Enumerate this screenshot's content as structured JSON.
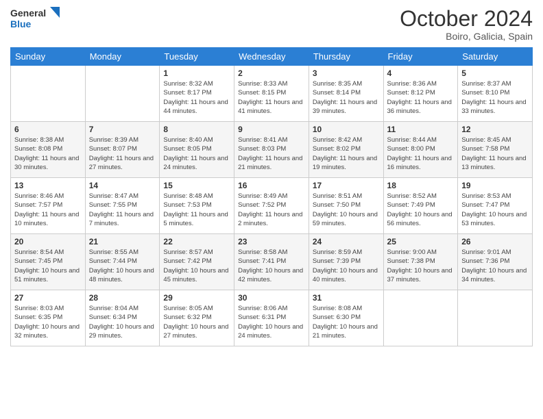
{
  "logo": {
    "general": "General",
    "blue": "Blue"
  },
  "title": "October 2024",
  "subtitle": "Boiro, Galicia, Spain",
  "days_header": [
    "Sunday",
    "Monday",
    "Tuesday",
    "Wednesday",
    "Thursday",
    "Friday",
    "Saturday"
  ],
  "weeks": [
    [
      {
        "day": "",
        "info": ""
      },
      {
        "day": "",
        "info": ""
      },
      {
        "day": "1",
        "info": "Sunrise: 8:32 AM\nSunset: 8:17 PM\nDaylight: 11 hours and 44 minutes."
      },
      {
        "day": "2",
        "info": "Sunrise: 8:33 AM\nSunset: 8:15 PM\nDaylight: 11 hours and 41 minutes."
      },
      {
        "day": "3",
        "info": "Sunrise: 8:35 AM\nSunset: 8:14 PM\nDaylight: 11 hours and 39 minutes."
      },
      {
        "day": "4",
        "info": "Sunrise: 8:36 AM\nSunset: 8:12 PM\nDaylight: 11 hours and 36 minutes."
      },
      {
        "day": "5",
        "info": "Sunrise: 8:37 AM\nSunset: 8:10 PM\nDaylight: 11 hours and 33 minutes."
      }
    ],
    [
      {
        "day": "6",
        "info": "Sunrise: 8:38 AM\nSunset: 8:08 PM\nDaylight: 11 hours and 30 minutes."
      },
      {
        "day": "7",
        "info": "Sunrise: 8:39 AM\nSunset: 8:07 PM\nDaylight: 11 hours and 27 minutes."
      },
      {
        "day": "8",
        "info": "Sunrise: 8:40 AM\nSunset: 8:05 PM\nDaylight: 11 hours and 24 minutes."
      },
      {
        "day": "9",
        "info": "Sunrise: 8:41 AM\nSunset: 8:03 PM\nDaylight: 11 hours and 21 minutes."
      },
      {
        "day": "10",
        "info": "Sunrise: 8:42 AM\nSunset: 8:02 PM\nDaylight: 11 hours and 19 minutes."
      },
      {
        "day": "11",
        "info": "Sunrise: 8:44 AM\nSunset: 8:00 PM\nDaylight: 11 hours and 16 minutes."
      },
      {
        "day": "12",
        "info": "Sunrise: 8:45 AM\nSunset: 7:58 PM\nDaylight: 11 hours and 13 minutes."
      }
    ],
    [
      {
        "day": "13",
        "info": "Sunrise: 8:46 AM\nSunset: 7:57 PM\nDaylight: 11 hours and 10 minutes."
      },
      {
        "day": "14",
        "info": "Sunrise: 8:47 AM\nSunset: 7:55 PM\nDaylight: 11 hours and 7 minutes."
      },
      {
        "day": "15",
        "info": "Sunrise: 8:48 AM\nSunset: 7:53 PM\nDaylight: 11 hours and 5 minutes."
      },
      {
        "day": "16",
        "info": "Sunrise: 8:49 AM\nSunset: 7:52 PM\nDaylight: 11 hours and 2 minutes."
      },
      {
        "day": "17",
        "info": "Sunrise: 8:51 AM\nSunset: 7:50 PM\nDaylight: 10 hours and 59 minutes."
      },
      {
        "day": "18",
        "info": "Sunrise: 8:52 AM\nSunset: 7:49 PM\nDaylight: 10 hours and 56 minutes."
      },
      {
        "day": "19",
        "info": "Sunrise: 8:53 AM\nSunset: 7:47 PM\nDaylight: 10 hours and 53 minutes."
      }
    ],
    [
      {
        "day": "20",
        "info": "Sunrise: 8:54 AM\nSunset: 7:45 PM\nDaylight: 10 hours and 51 minutes."
      },
      {
        "day": "21",
        "info": "Sunrise: 8:55 AM\nSunset: 7:44 PM\nDaylight: 10 hours and 48 minutes."
      },
      {
        "day": "22",
        "info": "Sunrise: 8:57 AM\nSunset: 7:42 PM\nDaylight: 10 hours and 45 minutes."
      },
      {
        "day": "23",
        "info": "Sunrise: 8:58 AM\nSunset: 7:41 PM\nDaylight: 10 hours and 42 minutes."
      },
      {
        "day": "24",
        "info": "Sunrise: 8:59 AM\nSunset: 7:39 PM\nDaylight: 10 hours and 40 minutes."
      },
      {
        "day": "25",
        "info": "Sunrise: 9:00 AM\nSunset: 7:38 PM\nDaylight: 10 hours and 37 minutes."
      },
      {
        "day": "26",
        "info": "Sunrise: 9:01 AM\nSunset: 7:36 PM\nDaylight: 10 hours and 34 minutes."
      }
    ],
    [
      {
        "day": "27",
        "info": "Sunrise: 8:03 AM\nSunset: 6:35 PM\nDaylight: 10 hours and 32 minutes."
      },
      {
        "day": "28",
        "info": "Sunrise: 8:04 AM\nSunset: 6:34 PM\nDaylight: 10 hours and 29 minutes."
      },
      {
        "day": "29",
        "info": "Sunrise: 8:05 AM\nSunset: 6:32 PM\nDaylight: 10 hours and 27 minutes."
      },
      {
        "day": "30",
        "info": "Sunrise: 8:06 AM\nSunset: 6:31 PM\nDaylight: 10 hours and 24 minutes."
      },
      {
        "day": "31",
        "info": "Sunrise: 8:08 AM\nSunset: 6:30 PM\nDaylight: 10 hours and 21 minutes."
      },
      {
        "day": "",
        "info": ""
      },
      {
        "day": "",
        "info": ""
      }
    ]
  ]
}
